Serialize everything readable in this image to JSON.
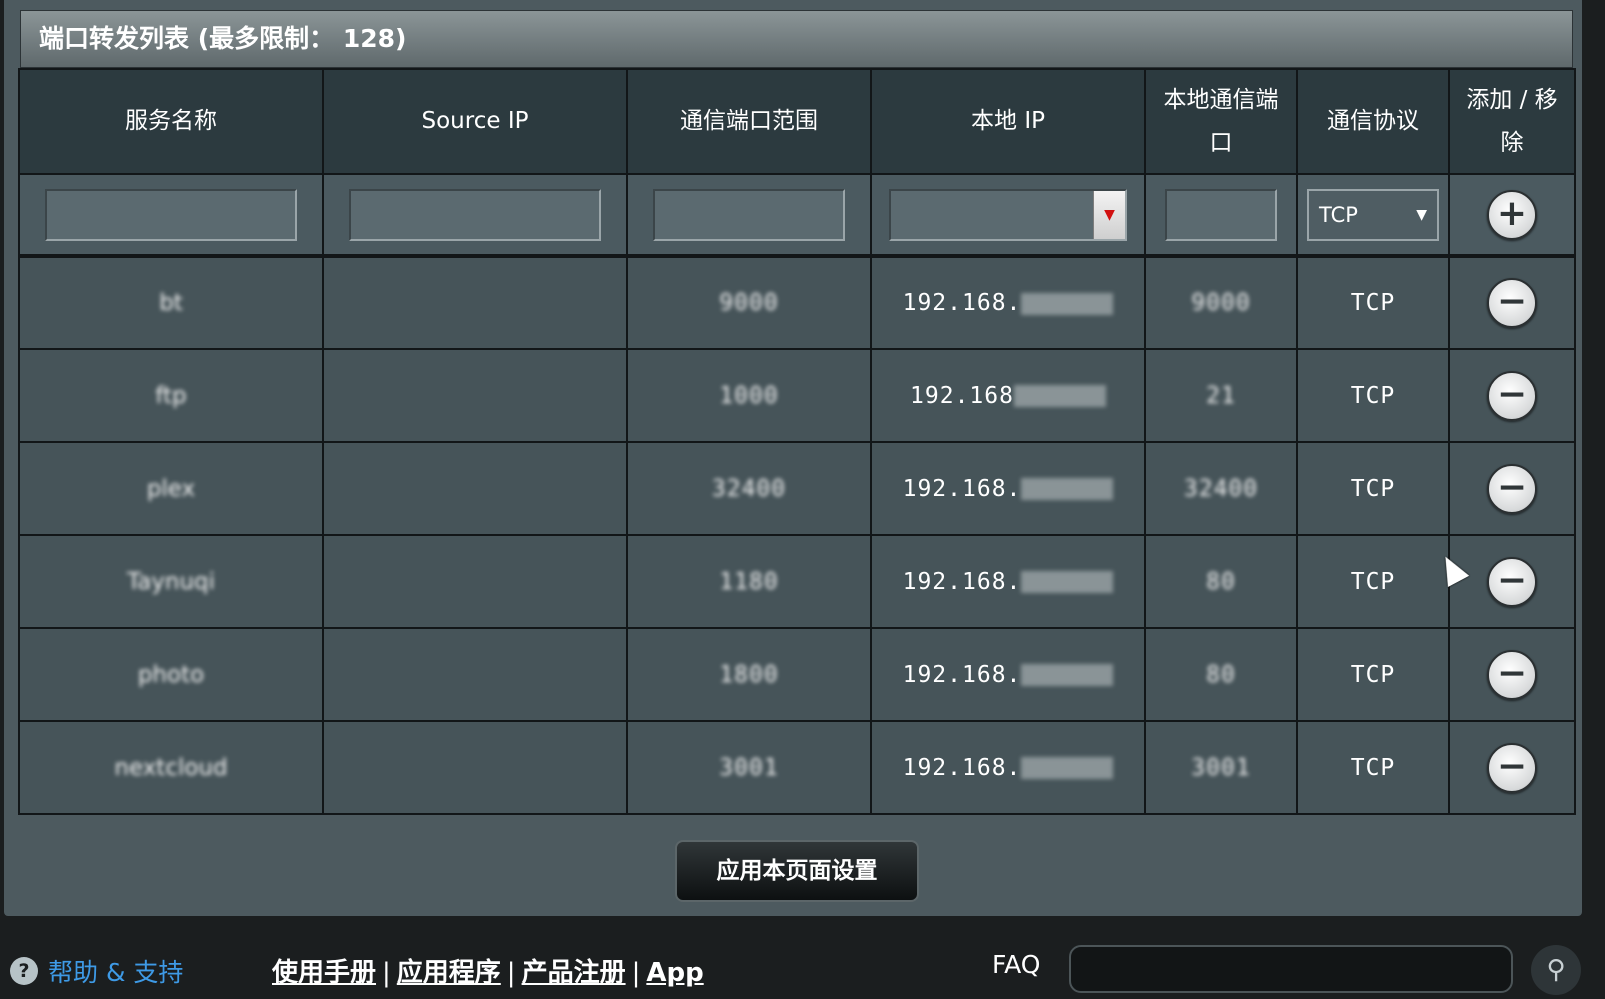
{
  "title": "端口转发列表 (最多限制： 128)",
  "columns": [
    "服务名称",
    "Source IP",
    "通信端口范围",
    "本地 IP",
    "本地通信端口",
    "通信协议",
    "添加 / 移除"
  ],
  "input_row": {
    "service_name": "",
    "source_ip": "",
    "port_range": "",
    "local_ip": "",
    "local_port": "",
    "protocol": "TCP"
  },
  "rows": [
    {
      "service": "bt",
      "source_ip": "",
      "port_range": "9000",
      "local_ip": "192.168.",
      "local_port": "9000",
      "protocol": "TCP"
    },
    {
      "service": "ftp",
      "source_ip": "",
      "port_range": "1000",
      "local_ip": "192.168",
      "local_port": "21",
      "protocol": "TCP"
    },
    {
      "service": "plex",
      "source_ip": "",
      "port_range": "32400",
      "local_ip": "192.168.",
      "local_port": "32400",
      "protocol": "TCP"
    },
    {
      "service": "Taynuqi",
      "source_ip": "",
      "port_range": "1180",
      "local_ip": "192.168.",
      "local_port": "80",
      "protocol": "TCP"
    },
    {
      "service": "photo",
      "source_ip": "",
      "port_range": "1800",
      "local_ip": "192.168.",
      "local_port": "80",
      "protocol": "TCP"
    },
    {
      "service": "nextcloud",
      "source_ip": "",
      "port_range": "3001",
      "local_ip": "192.168.",
      "local_port": "3001",
      "protocol": "TCP"
    }
  ],
  "apply_button": "应用本页面设置",
  "footer": {
    "help": "帮助 & 支持",
    "links": [
      "使用手册",
      "应用程序",
      "产品注册",
      "App"
    ],
    "faq_label": "FAQ",
    "faq_value": ""
  },
  "icons": {
    "add": "plus-circle-icon",
    "remove": "minus-circle-icon",
    "search": "magnifier-icon",
    "help": "question-circle-icon"
  }
}
